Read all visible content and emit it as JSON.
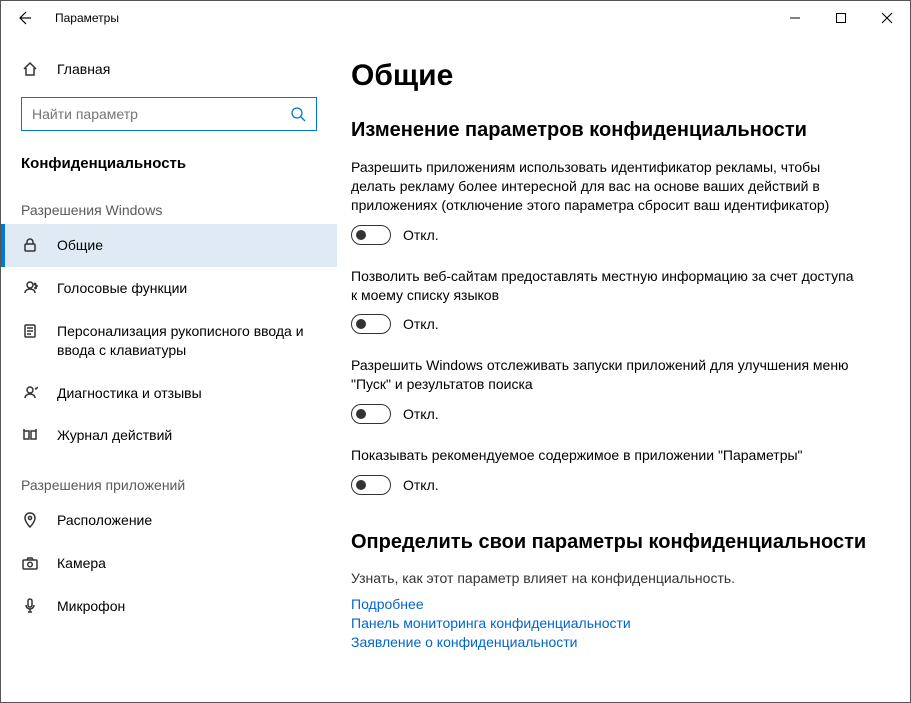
{
  "window": {
    "title": "Параметры"
  },
  "sidebar": {
    "home": "Главная",
    "search_placeholder": "Найти параметр",
    "category": "Конфиденциальность",
    "group_windows": "Разрешения Windows",
    "group_apps": "Разрешения приложений",
    "items_windows": [
      {
        "label": "Общие",
        "icon": "lock"
      },
      {
        "label": "Голосовые функции",
        "icon": "speech"
      },
      {
        "label": "Персонализация рукописного ввода и ввода с клавиатуры",
        "icon": "clipboard"
      },
      {
        "label": "Диагностика и отзывы",
        "icon": "feedback"
      },
      {
        "label": "Журнал действий",
        "icon": "history"
      }
    ],
    "items_apps": [
      {
        "label": "Расположение",
        "icon": "location"
      },
      {
        "label": "Камера",
        "icon": "camera"
      },
      {
        "label": "Микрофон",
        "icon": "microphone"
      }
    ]
  },
  "main": {
    "heading": "Общие",
    "section1_title": "Изменение параметров конфиденциальности",
    "options": [
      {
        "desc": "Разрешить приложениям использовать идентификатор рекламы, чтобы делать рекламу более интересной для вас на основе ваших действий в приложениях (отключение этого параметра сбросит ваш идентификатор)",
        "state": "Откл."
      },
      {
        "desc": "Позволить веб-сайтам предоставлять местную информацию за счет доступа к моему списку языков",
        "state": "Откл."
      },
      {
        "desc": "Разрешить Windows отслеживать запуски приложений для улучшения меню \"Пуск\" и результатов поиска",
        "state": "Откл."
      },
      {
        "desc": "Показывать рекомендуемое содержимое в приложении \"Параметры\"",
        "state": "Откл."
      }
    ],
    "section2_title": "Определить свои параметры конфиденциальности",
    "section2_sub": "Узнать, как этот параметр влияет на конфиденциальность.",
    "links": [
      "Подробнее",
      "Панель мониторинга конфиденциальности",
      "Заявление о конфиденциальности"
    ]
  }
}
